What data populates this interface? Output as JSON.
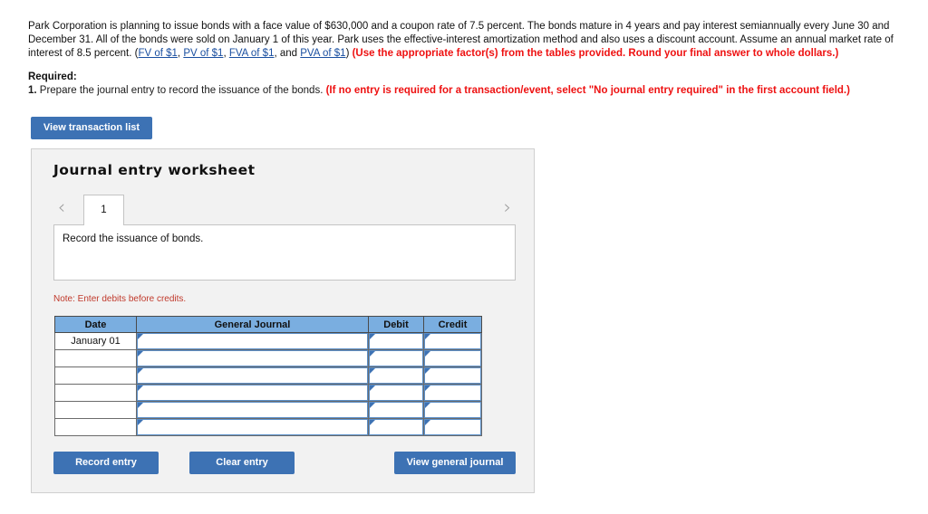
{
  "problem": {
    "segment_1": "Park Corporation is planning to issue bonds with a face value of $630,000 and a coupon rate of 7.5 percent. The bonds mature in 4 years and pay interest semiannually every June 30 and December 31. All of the bonds were sold on January 1 of this year. Park uses the effective-interest amortization method and also uses a discount account. Assume an annual market rate of interest of 8.5 percent. (",
    "link_fv": "FV of $1",
    "sep_1": ", ",
    "link_pv": "PV of $1",
    "sep_2": ", ",
    "link_fva": "FVA of $1",
    "sep_3": ", and ",
    "link_pva": "PVA of $1",
    "segment_2": ") ",
    "emphasis": "(Use the appropriate factor(s) from the tables provided. Round your final answer to whole dollars.)"
  },
  "required": {
    "label": "Required:",
    "number": "1.",
    "text": " Prepare the journal entry to record the issuance of the bonds. ",
    "emphasis": "(If no entry is required for a transaction/event, select \"No journal entry required\" in the first account field.)"
  },
  "buttons": {
    "view_transaction_list": "View transaction list",
    "record_entry": "Record entry",
    "clear_entry": "Clear entry",
    "view_general_journal": "View general journal"
  },
  "worksheet": {
    "title": "Journal entry worksheet",
    "prev_icon": "‹",
    "next_icon": "›",
    "tabs": [
      {
        "label": "1",
        "active": true
      }
    ],
    "instruction": "Record the issuance of bonds.",
    "note": "Note: Enter debits before credits."
  },
  "journal_table": {
    "headers": [
      "Date",
      "General Journal",
      "Debit",
      "Credit"
    ],
    "rows": [
      {
        "date": "January 01",
        "general_journal": "",
        "debit": "",
        "credit": ""
      },
      {
        "date": "",
        "general_journal": "",
        "debit": "",
        "credit": ""
      },
      {
        "date": "",
        "general_journal": "",
        "debit": "",
        "credit": ""
      },
      {
        "date": "",
        "general_journal": "",
        "debit": "",
        "credit": ""
      },
      {
        "date": "",
        "general_journal": "",
        "debit": "",
        "credit": ""
      },
      {
        "date": "",
        "general_journal": "",
        "debit": "",
        "credit": ""
      }
    ]
  },
  "colors": {
    "button_blue": "#3d72b4",
    "header_blue": "#7aaee0",
    "emphasis_red": "#ee1111",
    "note_red": "#c0392b",
    "link_blue": "#1a4fa0",
    "panel_gray": "#f2f2f2"
  }
}
